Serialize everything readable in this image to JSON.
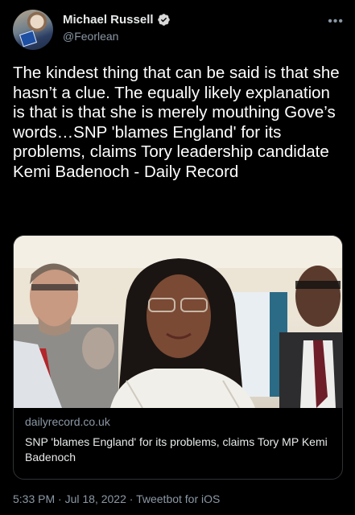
{
  "author": {
    "display_name": "Michael Russell",
    "handle": "@Feorlean"
  },
  "tweet": {
    "text": "The kindest thing that can be said is that she hasn’t a clue. The equally likely explanation is that is that she is merely mouthing Gove’s words…SNP 'blames England' for its problems, claims Tory leadership candidate Kemi Badenoch - Daily Record"
  },
  "link_card": {
    "domain": "dailyrecord.co.uk",
    "title": "SNP 'blames England' for its problems, claims Tory MP Kemi Badenoch"
  },
  "meta": {
    "time": "5:33 PM",
    "separator": "·",
    "date": "Jul 18, 2022",
    "client": "Tweetbot for iOS"
  },
  "icons": {
    "verified": "verified-badge-icon",
    "more": "more-options-icon"
  },
  "colors": {
    "background": "#000000",
    "text": "#e7e9ea",
    "secondary": "#8b98a5",
    "border": "#2f3336"
  }
}
